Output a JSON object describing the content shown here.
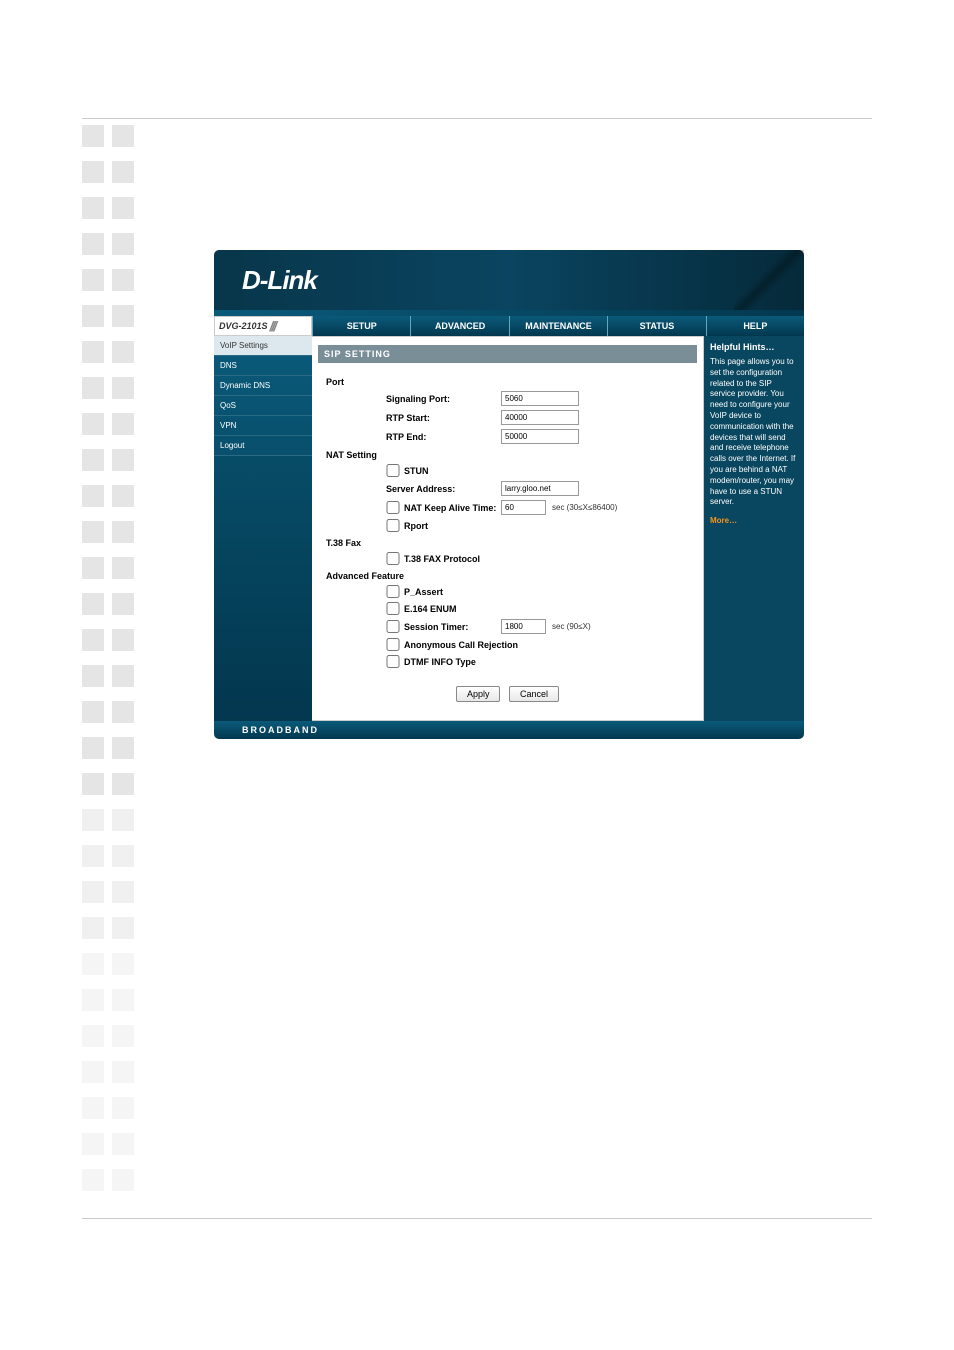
{
  "model": "DVG-2101S",
  "logo_text": "D-Link",
  "footer_text": "BROADBAND",
  "nav": {
    "setup": "SETUP",
    "advanced": "ADVANCED",
    "maintenance": "MAINTENANCE",
    "status": "STATUS",
    "help": "HELP"
  },
  "side": {
    "voip": "VoIP Settings",
    "dns": "DNS",
    "dyndns": "Dynamic DNS",
    "qos": "QoS",
    "vpn": "VPN",
    "logout": "Logout"
  },
  "section_title": "SIP SETTING",
  "groups": {
    "port": "Port",
    "nat": "NAT Setting",
    "t38": "T.38 Fax",
    "adv": "Advanced Feature"
  },
  "labels": {
    "sig_port": "Signaling Port:",
    "rtp_start": "RTP Start:",
    "rtp_end": "RTP End:",
    "stun": "STUN",
    "server_addr": "Server Address:",
    "nat_keep": "NAT Keep Alive Time:",
    "rport": "Rport",
    "t38proto": "T.38 FAX Protocol",
    "passert": "P_Assert",
    "e164": "E.164 ENUM",
    "session": "Session Timer:",
    "anon": "Anonymous Call Rejection",
    "dtmf": "DTMF INFO Type"
  },
  "values": {
    "sig_port": "5060",
    "rtp_start": "40000",
    "rtp_end": "50000",
    "server_addr": "larry.gloo.net",
    "nat_keep": "60",
    "session": "1800"
  },
  "suffix": {
    "nat_keep": "sec   (30≤X≤86400)",
    "session": "sec   (90≤X)"
  },
  "buttons": {
    "apply": "Apply",
    "cancel": "Cancel"
  },
  "help": {
    "heading": "Helpful Hints…",
    "body": "This page allows you to set the configuration related to the SIP service provider. You need to configure your VoIP device to communication with the devices that will send and receive telephone calls over the Internet. If you are behind a NAT modem/router, you may have to use a STUN server.",
    "more": "More…"
  }
}
